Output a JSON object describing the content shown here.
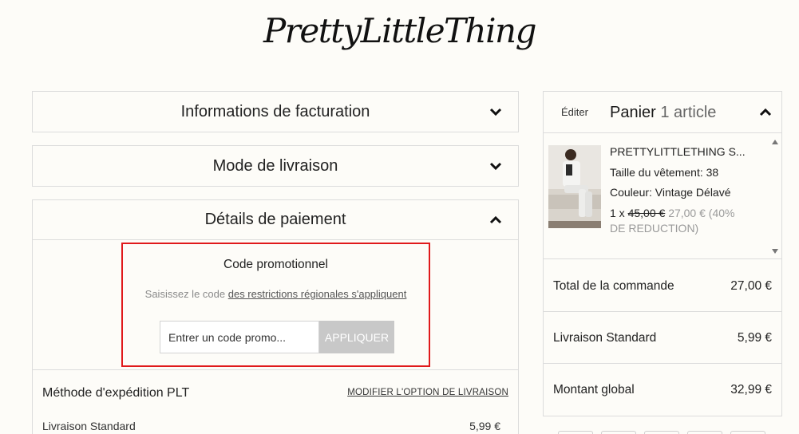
{
  "brand": {
    "logo": "PrettyLittleThing"
  },
  "sections": {
    "billing": {
      "title": "Informations de facturation"
    },
    "delivery": {
      "title": "Mode de livraison"
    },
    "payment": {
      "title": "Détails de paiement"
    }
  },
  "promo": {
    "title": "Code promotionnel",
    "help_prefix": "Saisissez le code",
    "help_link": "des restrictions régionales s'appliquent",
    "input_placeholder": "Entrer un code promo...",
    "apply_label": "APPLIQUER"
  },
  "shipping": {
    "title": "Méthode d'expédition PLT",
    "modify_link": "MODIFIER L'OPTION DE LIVRAISON",
    "option_name": "Livraison Standard",
    "option_price": "5,99 €"
  },
  "cart": {
    "edit_label": "Éditer",
    "title": "Panier",
    "count": "1 article",
    "item": {
      "name": "PRETTYLITTLETHING S...",
      "size": "Taille du vêtement: 38",
      "color": "Couleur: Vintage Délavé",
      "qty": "1 x",
      "old_price": "45,00 €",
      "new_price": "27,00 € (40%",
      "discount": "DE REDUCTION)"
    },
    "summary": [
      {
        "label": "Total de la commande",
        "value": "27,00 €"
      },
      {
        "label": "Livraison Standard",
        "value": "5,99 €"
      },
      {
        "label": "Montant global",
        "value": "32,99 €"
      }
    ]
  },
  "colors": {
    "highlight": "#e0191b",
    "button_disabled": "#c8c8c8",
    "background": "#fdfcf8"
  }
}
